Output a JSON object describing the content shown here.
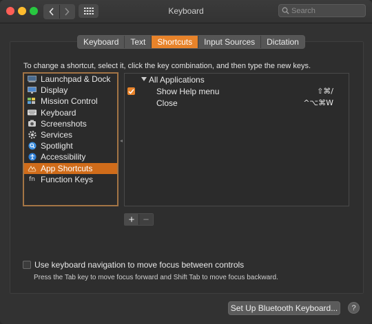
{
  "window": {
    "title": "Keyboard",
    "search_placeholder": "Search"
  },
  "tabs": [
    {
      "label": "Keyboard",
      "active": false
    },
    {
      "label": "Text",
      "active": false
    },
    {
      "label": "Shortcuts",
      "active": true
    },
    {
      "label": "Input Sources",
      "active": false
    },
    {
      "label": "Dictation",
      "active": false
    }
  ],
  "instructions": "To change a shortcut, select it, click the key combination, and then type the new keys.",
  "categories": [
    {
      "label": "Launchpad & Dock",
      "icon": "launchpad-dock-icon"
    },
    {
      "label": "Display",
      "icon": "display-icon"
    },
    {
      "label": "Mission Control",
      "icon": "mission-control-icon"
    },
    {
      "label": "Keyboard",
      "icon": "keyboard-icon"
    },
    {
      "label": "Screenshots",
      "icon": "screenshots-icon"
    },
    {
      "label": "Services",
      "icon": "services-gear-icon"
    },
    {
      "label": "Spotlight",
      "icon": "spotlight-icon"
    },
    {
      "label": "Accessibility",
      "icon": "accessibility-icon"
    },
    {
      "label": "App Shortcuts",
      "icon": "app-shortcuts-icon",
      "selected": true
    },
    {
      "label": "Function Keys",
      "icon": "function-keys-icon"
    }
  ],
  "shortcuts": {
    "group_label": "All Applications",
    "rows": [
      {
        "name": "Show Help menu",
        "keys": "⇧⌘/",
        "checked": true
      },
      {
        "name": "Close",
        "keys": "^⌥⌘W",
        "checked": false
      }
    ]
  },
  "buttons": {
    "add": "+",
    "remove": "−",
    "bluetooth": "Set Up Bluetooth Keyboard...",
    "help": "?"
  },
  "keyboard_navigation": {
    "label": "Use keyboard navigation to move focus between controls",
    "hint": "Press the Tab key to move focus forward and Shift Tab to move focus backward.",
    "checked": false
  },
  "colors": {
    "accent": "#e8832a",
    "selection": "#d06c1a"
  }
}
